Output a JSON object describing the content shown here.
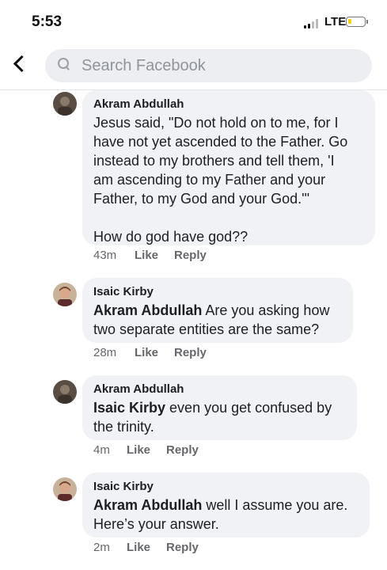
{
  "status": {
    "time": "5:53",
    "network": "LTE",
    "signal_icon": "signal-bars-icon",
    "battery_icon": "battery-icon",
    "battery_color": "#f4d100"
  },
  "header": {
    "back_icon": "chevron-left-icon",
    "search_placeholder": "Search Facebook",
    "search_value": ""
  },
  "comments": [
    {
      "author": "Akram Abdullah",
      "mention": "",
      "lines": [
        "Jesus said, \"Do not hold on to me, for I",
        "have not yet ascended to the Father. Go",
        "instead to my brothers and tell them, 'I",
        "am ascending to my Father and your",
        "Father, to my God and your God.'\"",
        "",
        "How do god have god??"
      ],
      "time": "43m",
      "like_label": "Like",
      "reply_label": "Reply"
    },
    {
      "author": "Isaic Kirby",
      "mention": "Akram Abdullah",
      "lines": [
        " Are you asking how",
        "two separate entities are the same?"
      ],
      "time": "28m",
      "like_label": "Like",
      "reply_label": "Reply"
    },
    {
      "author": "Akram Abdullah",
      "mention": "Isaic Kirby",
      "lines": [
        " even you get confused by",
        "the trinity."
      ],
      "time": "4m",
      "like_label": "Like",
      "reply_label": "Reply"
    },
    {
      "author": "Isaic Kirby",
      "mention": "Akram Abdullah",
      "lines": [
        " well I assume you are.",
        "Here’s your answer."
      ],
      "time": "2m",
      "like_label": "Like",
      "reply_label": "Reply"
    }
  ]
}
